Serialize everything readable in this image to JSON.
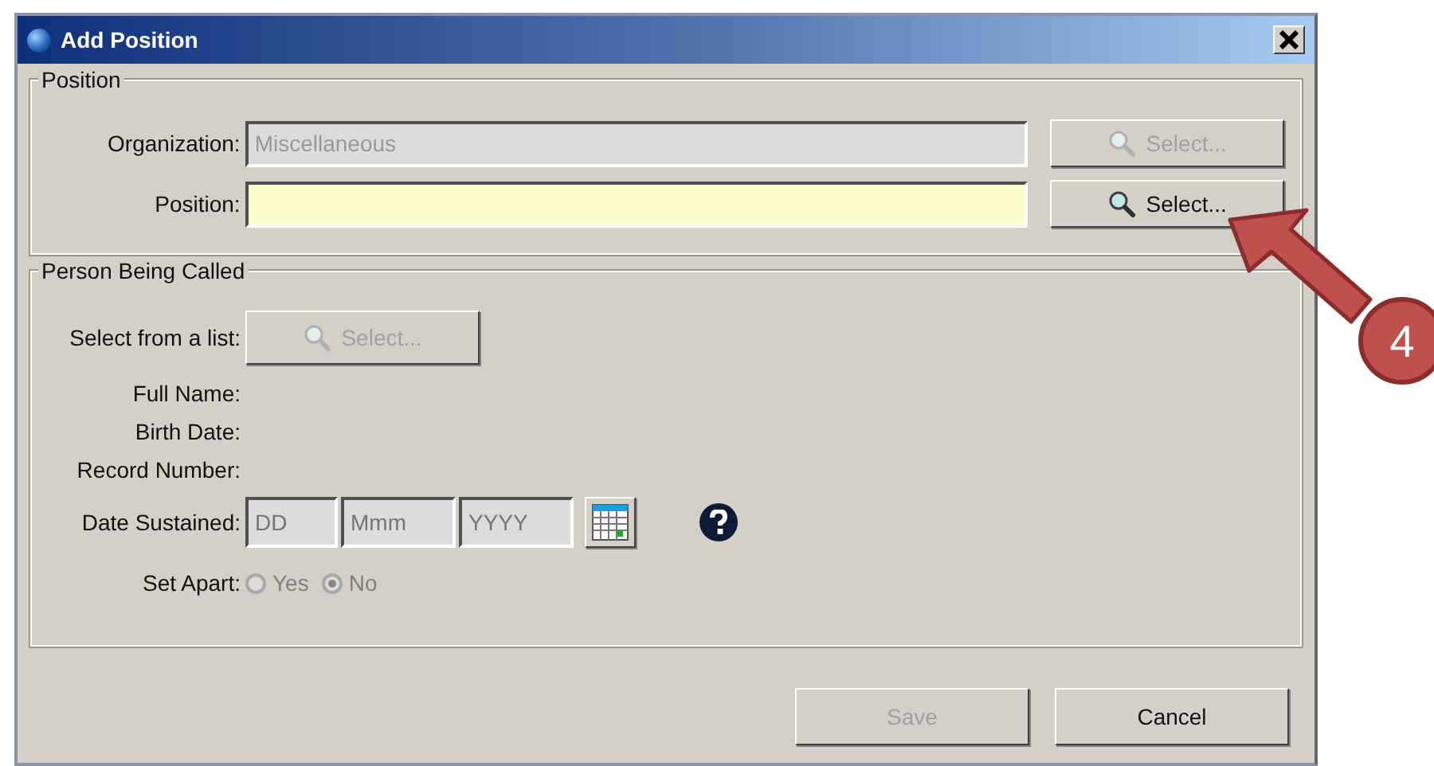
{
  "window": {
    "title": "Add Position"
  },
  "position_group": {
    "legend": "Position",
    "fields": [
      {
        "label": "Organization:",
        "value": "Miscellaneous",
        "disabled": true,
        "button": {
          "label": "Select...",
          "disabled": true
        }
      },
      {
        "label": "Position:",
        "disabled": false,
        "button": {
          "label": "Select...",
          "disabled": false
        }
      }
    ]
  },
  "person_group": {
    "legend": "Person Being Called",
    "select_row": {
      "label": "Select from a list:",
      "button": {
        "label": "Select...",
        "disabled": true
      }
    },
    "info_labels": [
      "Full Name:",
      "Birth Date:",
      "Record Number:"
    ],
    "date_sustained": {
      "label": "Date Sustained:",
      "disabled": true,
      "parts": [
        {
          "placeholder": "DD"
        },
        {
          "placeholder": "Mmm"
        },
        {
          "placeholder": "YYYY"
        }
      ]
    },
    "set_apart": {
      "label": "Set Apart:",
      "disabled": true,
      "options": [
        {
          "label": "Yes",
          "selected": false
        },
        {
          "label": "No",
          "selected": true
        }
      ]
    }
  },
  "buttons": [
    {
      "label": "Save",
      "disabled": true
    },
    {
      "label": "Cancel",
      "disabled": false
    }
  ],
  "annotation": {
    "number": "4"
  }
}
